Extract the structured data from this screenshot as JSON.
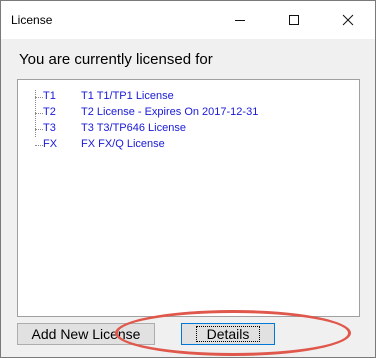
{
  "window": {
    "title": "License"
  },
  "titlebar": {
    "minimize_icon": "minimize-icon",
    "maximize_icon": "maximize-icon",
    "close_icon": "close-icon"
  },
  "content": {
    "heading": "You are currently licensed for",
    "licenses": [
      {
        "code": "T1",
        "description": "T1 T1/TP1 License"
      },
      {
        "code": "T2",
        "description": "T2 License - Expires On 2017-12-31"
      },
      {
        "code": "T3",
        "description": "T3 T3/TP646 License"
      },
      {
        "code": "FX",
        "description": "FX FX/Q License"
      }
    ]
  },
  "buttons": {
    "add_new_license": "Add New License",
    "details": "Details"
  },
  "colors": {
    "license_text": "#1a1ad8",
    "annotation": "#e0574b",
    "focus_border": "#0078d7"
  }
}
